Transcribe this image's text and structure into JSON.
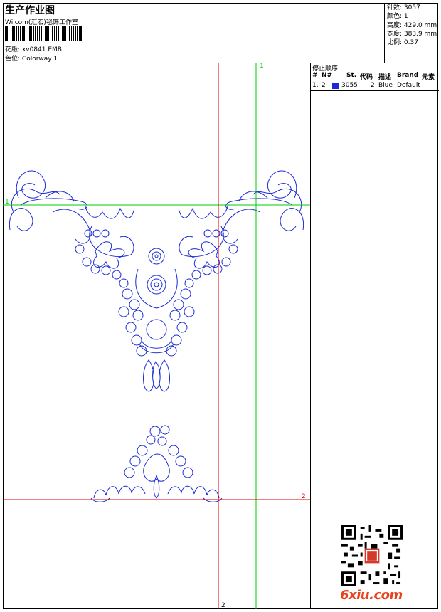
{
  "header": {
    "title": "生产作业图",
    "studio": "Wilcom(汇宏)毯饰工作室",
    "design_label": "花版:",
    "design_file": "xv0841.EMB",
    "colorway_label": "色位:",
    "colorway": "Colorway 1"
  },
  "stats": [
    {
      "label": "针数:",
      "value": "3057"
    },
    {
      "label": "颜色:",
      "value": "1"
    },
    {
      "label": "高度:",
      "value": "429.0 mm"
    },
    {
      "label": "宽度:",
      "value": "383.9 mm"
    },
    {
      "label": "比例:",
      "value": "0.37"
    }
  ],
  "stop_sequence": {
    "title": "停止顺序:",
    "columns": [
      "#",
      "N#",
      "St.",
      "代码",
      "描述",
      "Brand",
      "元素"
    ],
    "rows": [
      {
        "num": "1.",
        "n": "2",
        "color": "#1a2bd6",
        "st": "3055",
        "code": "2",
        "desc": "Blue",
        "brand": "Default",
        "element": ""
      }
    ]
  },
  "guides": {
    "green_v": "1",
    "green_h": "1",
    "red_h": "2",
    "red_v": "2"
  },
  "colors": {
    "stitch": "#1a2bd6",
    "guide_green": "#00cc00",
    "guide_red": "#e00000",
    "watermark": "#e8431f"
  },
  "watermark": "6xiu.com"
}
